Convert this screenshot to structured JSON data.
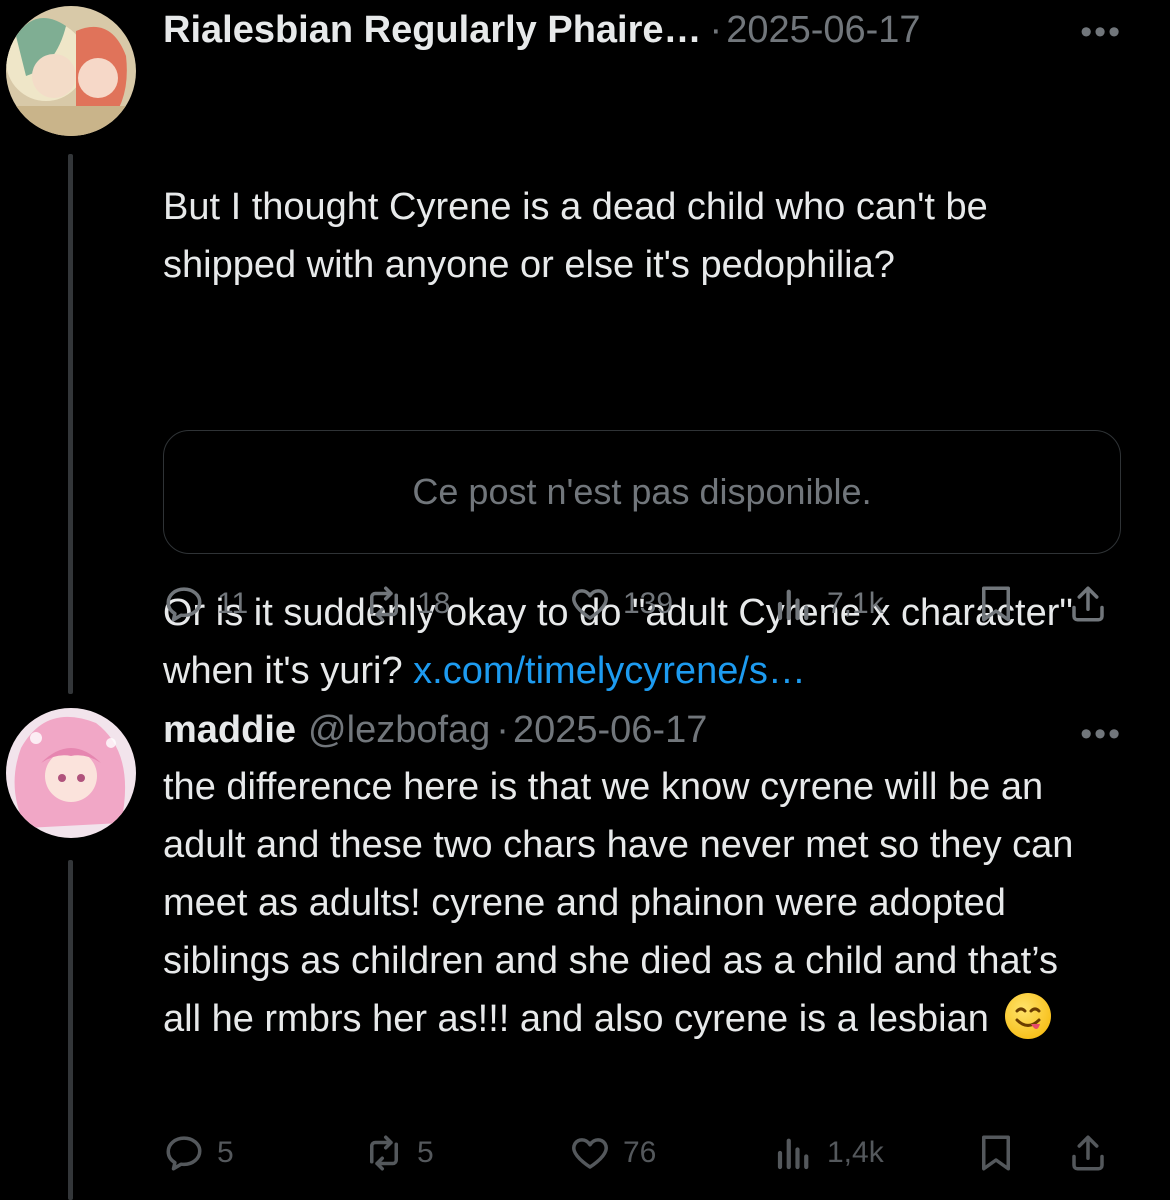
{
  "tweets": [
    {
      "author_name": "Rialesbian Regularly Phaire…",
      "separator": "·",
      "date": "2025-06-17",
      "more": "•••",
      "text_line1": "But I thought Cyrene is a dead child who can't be shipped with anyone or else it's pedophilia?",
      "text_line2_prefix": "Or is it suddenly okay to do \"adult Cyrene x character\" when it's yuri? ",
      "link": "x.com/timelycyrene/s…",
      "quote_unavailable": "Ce post n'est pas disponible.",
      "replies": "11",
      "reposts": "18",
      "likes": "139",
      "views": "7,1k"
    },
    {
      "author_name": "maddie",
      "handle": "@lezbofag",
      "separator": "·",
      "date": "2025-06-17",
      "more": "•••",
      "text": "the difference here is that we know cyrene will be an adult and these two chars have never met so they can meet as adults! cyrene and phainon were adopted siblings as children and she died as a child and that’s all he rmbrs her as!!! and also cyrene is a lesbian",
      "emoji": "savoring-food-emoji",
      "replies": "5",
      "reposts": "5",
      "likes": "76",
      "views": "1,4k"
    }
  ],
  "icons": {
    "reply": "reply-icon",
    "repost": "repost-icon",
    "like": "heart-icon",
    "views": "views-icon",
    "bookmark": "bookmark-icon",
    "share": "share-icon"
  },
  "colors": {
    "background": "#000000",
    "text": "#e7e9ea",
    "muted": "#71767b",
    "link": "#1d9bf0",
    "border": "#2f3336"
  }
}
